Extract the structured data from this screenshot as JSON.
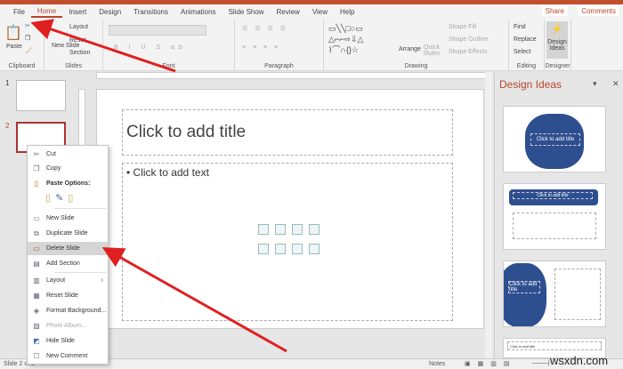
{
  "ribbon_tabs": [
    "File",
    "Home",
    "Insert",
    "Design",
    "Transitions",
    "Animations",
    "Slide Show",
    "Review",
    "View",
    "Help"
  ],
  "active_tab": "Home",
  "share": "Share",
  "comments": "Comments",
  "groups": {
    "clipboard": {
      "label": "Clipboard",
      "paste": "Paste"
    },
    "slides": {
      "label": "Slides",
      "new_slide": "New Slide",
      "layout": "Layout",
      "reset": "Reset",
      "section": "Section"
    },
    "font": {
      "label": "Font"
    },
    "paragraph": {
      "label": "Paragraph"
    },
    "drawing": {
      "label": "Drawing",
      "arrange": "Arrange",
      "quick_styles": "Quick Styles",
      "shape_fill": "Shape Fill",
      "shape_outline": "Shape Outline",
      "shape_effects": "Shape Effects"
    },
    "editing": {
      "label": "Editing",
      "find": "Find",
      "replace": "Replace",
      "select": "Select"
    },
    "designer": {
      "label": "Designer",
      "design_ideas": "Design Ideas"
    }
  },
  "thumbnails": [
    "1",
    "2"
  ],
  "slide": {
    "title_placeholder": "Click to add title",
    "text_placeholder": "• Click to add text"
  },
  "design_pane": {
    "title": "Design Ideas",
    "cards": [
      "Click to add title",
      "Click to add title",
      "Click to add title",
      "Click to add title"
    ]
  },
  "context_menu": {
    "items": [
      {
        "label": "Cut",
        "icon": "scissors-icon"
      },
      {
        "label": "Copy",
        "icon": "copy-icon"
      },
      {
        "label": "Paste Options:",
        "icon": "paste-icon"
      },
      {
        "label": "New Slide",
        "icon": "new-slide-icon"
      },
      {
        "label": "Duplicate Slide",
        "icon": "duplicate-icon"
      },
      {
        "label": "Delete Slide",
        "icon": "delete-slide-icon",
        "highlighted": true
      },
      {
        "label": "Add Section",
        "icon": "section-icon"
      },
      {
        "label": "Layout",
        "icon": "layout-icon"
      },
      {
        "label": "Reset Slide",
        "icon": "reset-icon"
      },
      {
        "label": "Format Background...",
        "icon": "format-background-icon"
      },
      {
        "label": "Photo Album...",
        "icon": "photo-album-icon",
        "disabled": true
      },
      {
        "label": "Hide Slide",
        "icon": "hide-slide-icon"
      },
      {
        "label": "New Comment",
        "icon": "comment-icon"
      }
    ]
  },
  "status": {
    "slide_info": "Slide 2 of 2",
    "notes": "Notes"
  },
  "watermark": "wsxdn.com",
  "colors": {
    "accent": "#b7472a",
    "arrow": "#e02020",
    "design_blue": "#2e4f8f"
  }
}
